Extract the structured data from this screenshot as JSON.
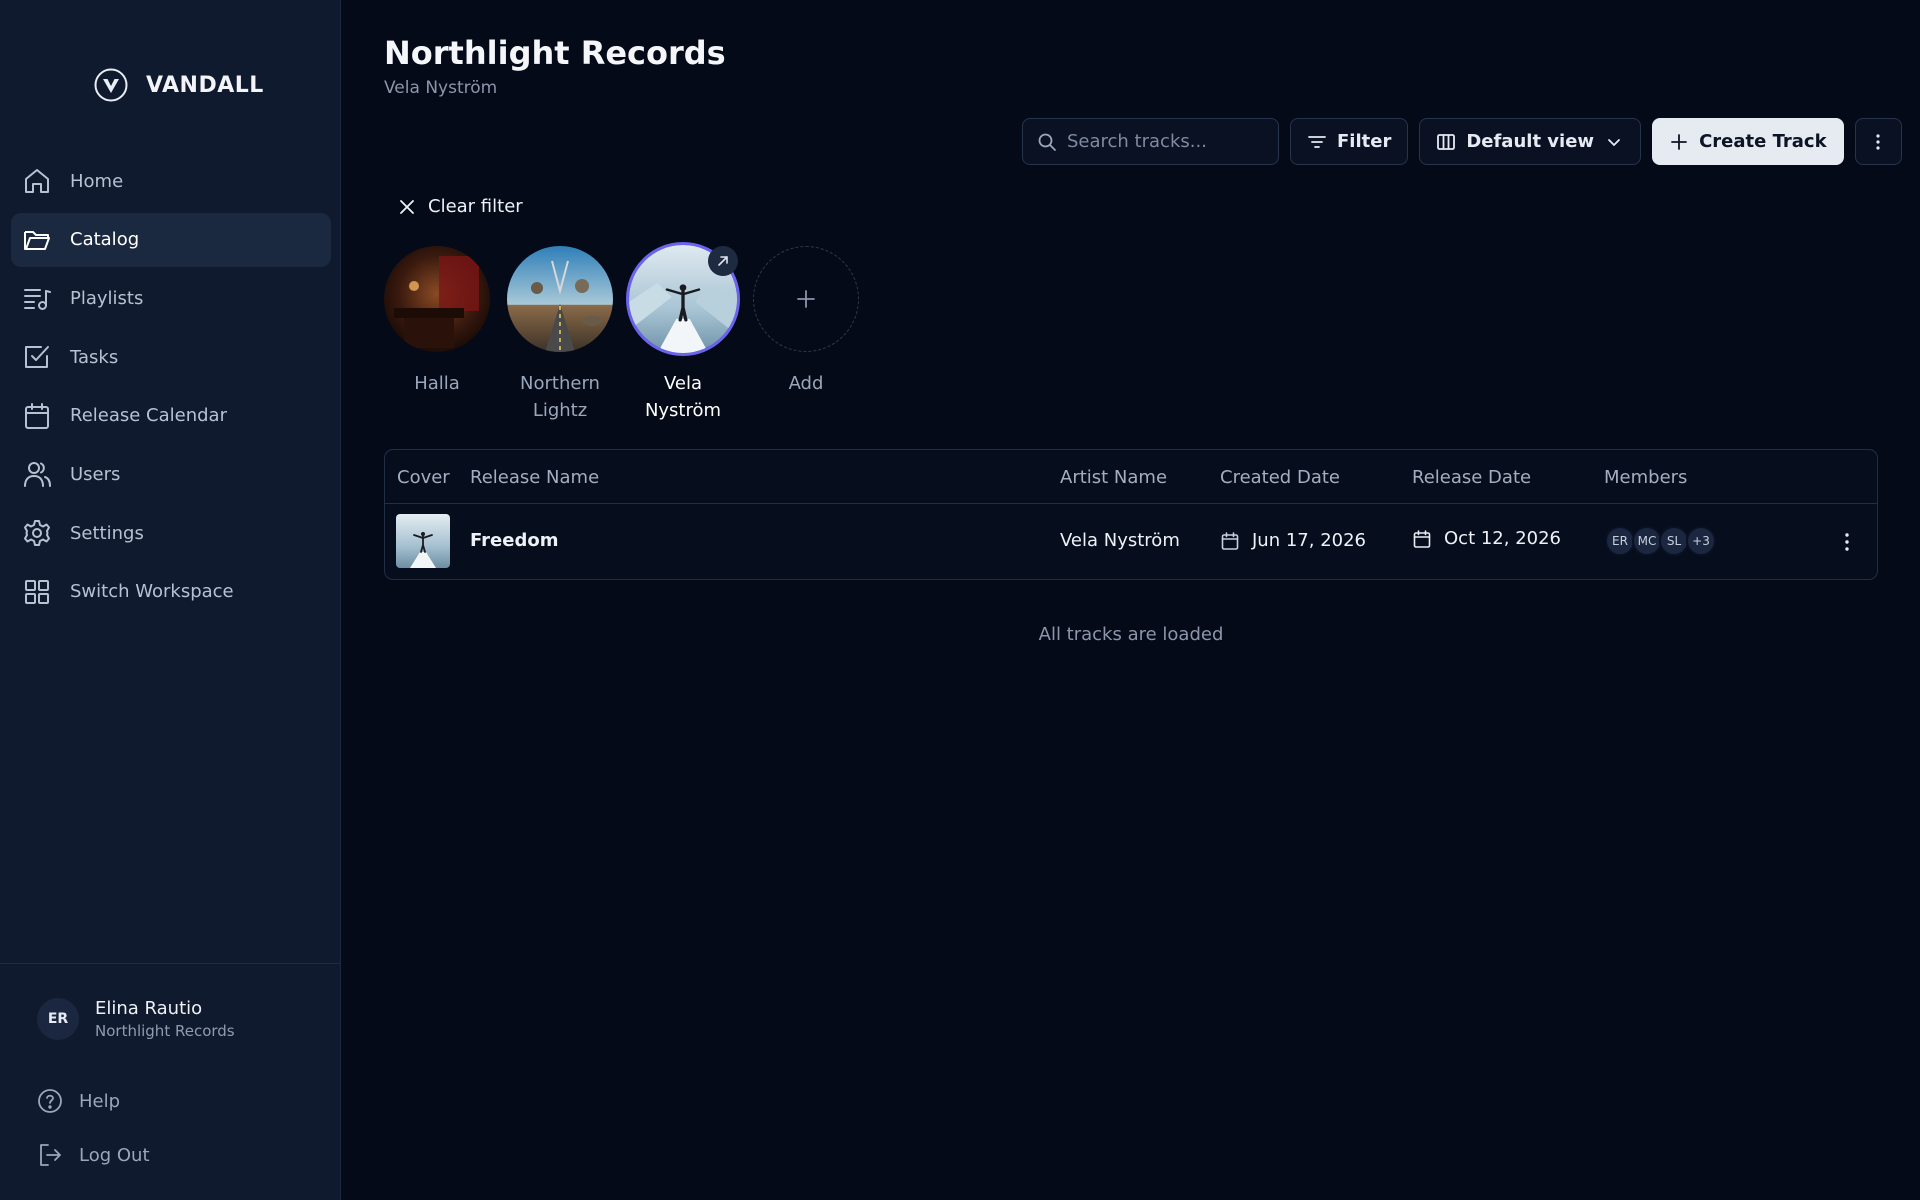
{
  "brand": {
    "name": "VANDALL",
    "logo_icon": "v-shield-logo"
  },
  "sidebar": {
    "items": [
      {
        "label": "Home",
        "icon": "home-icon",
        "active": false
      },
      {
        "label": "Catalog",
        "icon": "folder-icon",
        "active": true
      },
      {
        "label": "Playlists",
        "icon": "playlist-icon",
        "active": false
      },
      {
        "label": "Tasks",
        "icon": "checkbox-icon",
        "active": false
      },
      {
        "label": "Release Calendar",
        "icon": "calendar-icon",
        "active": false
      },
      {
        "label": "Users",
        "icon": "users-icon",
        "active": false
      },
      {
        "label": "Settings",
        "icon": "gear-icon",
        "active": false
      },
      {
        "label": "Switch Workspace",
        "icon": "grid-icon",
        "active": false
      }
    ],
    "user": {
      "initials": "ER",
      "name": "Elina Rautio",
      "org": "Northlight Records"
    },
    "help_label": "Help",
    "logout_label": "Log Out"
  },
  "header": {
    "title": "Northlight Records",
    "subtitle": "Vela Nyström"
  },
  "toolbar": {
    "search_placeholder": "Search tracks...",
    "filter_label": "Filter",
    "view_label": "Default view",
    "create_label": "Create Track"
  },
  "filter": {
    "clear_label": "Clear filter"
  },
  "artists": [
    {
      "name": "Halla",
      "selected": false
    },
    {
      "name": "Northern Lightz",
      "selected": false
    },
    {
      "name": "Vela Nyström",
      "selected": true
    },
    {
      "name": "Add",
      "selected": false
    }
  ],
  "table": {
    "columns": [
      "Cover",
      "Release Name",
      "Artist Name",
      "Created Date",
      "Release Date",
      "Members"
    ],
    "rows": [
      {
        "release_name": "Freedom",
        "artist_name": "Vela Nyström",
        "created_date": "Jun 17, 2026",
        "release_date": "Oct 12, 2026",
        "members": [
          "ER",
          "MC",
          "SL",
          "+3"
        ]
      }
    ],
    "footer_note": "All tracks are loaded"
  },
  "colors": {
    "background": "#050a18",
    "sidebar": "#0f1a2e",
    "accent_ring": "#6a63f0",
    "primary_button": "#e6eaf1"
  }
}
